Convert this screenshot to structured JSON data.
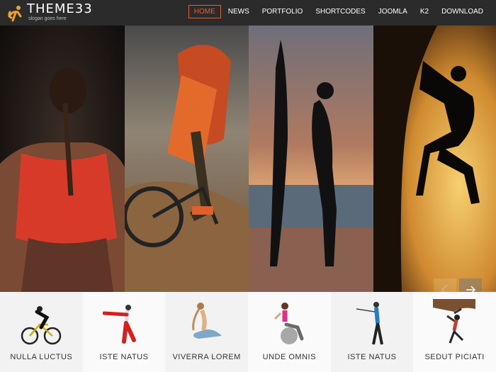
{
  "logo": {
    "word": "THEME33",
    "slogan": "slogan goes here"
  },
  "nav": {
    "items": [
      "HOME",
      "NEWS",
      "PORTFOLIO",
      "SHORTCODES",
      "JOOMLA",
      "K2",
      "DOWNLOAD"
    ],
    "active": "HOME"
  },
  "colors": {
    "accent": "#f05a28",
    "header_bg": "#2b2b2b"
  },
  "slider": {
    "panels": [
      "woman-back-red-top",
      "mountain-biker",
      "surfer-silhouette-sunset",
      "rock-climber-silhouette"
    ],
    "prev_icon": "chevron-left-icon",
    "next_icon": "chevron-right-icon"
  },
  "thumbs": [
    {
      "label": "NULLA LUCTUS",
      "icon": "cyclist-icon"
    },
    {
      "label": "ISTE NATUS",
      "icon": "martial-artist-icon"
    },
    {
      "label": "VIVERRA LOREM",
      "icon": "yoga-icon"
    },
    {
      "label": "UNDE OMNIS",
      "icon": "fitness-ball-icon"
    },
    {
      "label": "ISTE NATUS",
      "icon": "golfer-icon"
    },
    {
      "label": "SEDUT PICIATI",
      "icon": "climber-icon"
    }
  ]
}
